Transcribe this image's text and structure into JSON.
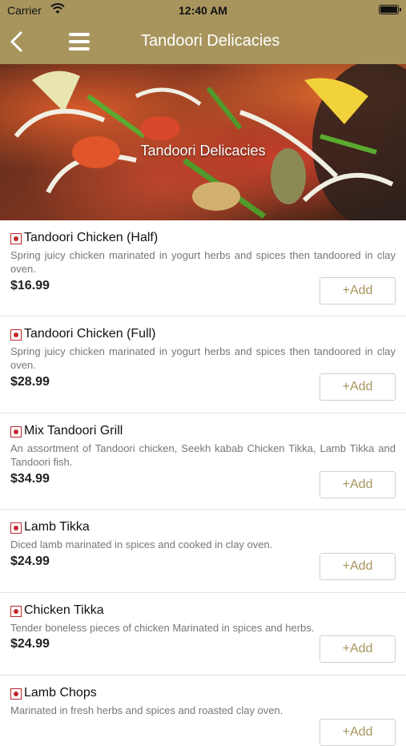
{
  "status_bar": {
    "carrier": "Carrier",
    "time": "12:40 AM"
  },
  "nav": {
    "title": "Tandoori Delicacies"
  },
  "banner": {
    "title": "Tandoori Delicacies"
  },
  "add_label": "+Add",
  "items": [
    {
      "name": "Tandoori Chicken (Half)",
      "desc": "Spring juicy chicken marinated in yogurt herbs and spices then tandoored in clay oven.",
      "price": "$16.99"
    },
    {
      "name": "Tandoori Chicken (Full)",
      "desc": "Spring juicy chicken marinated in yogurt herbs and spices then tandoored in clay oven.",
      "price": "$28.99"
    },
    {
      "name": "Mix Tandoori Grill",
      "desc": "An assortment of Tandoori chicken, Seekh kabab Chicken Tikka, Lamb Tikka and Tandoori fish.",
      "price": "$34.99"
    },
    {
      "name": "Lamb Tikka",
      "desc": "Diced lamb marinated in spices and cooked in clay oven.",
      "price": "$24.99"
    },
    {
      "name": "Chicken Tikka",
      "desc": "Tender boneless pieces of chicken Marinated in spices and herbs.",
      "price": "$24.99"
    },
    {
      "name": "Lamb Chops",
      "desc": "Marinated in fresh herbs and spices and roasted clay oven.",
      "price": ""
    }
  ],
  "colors": {
    "header": "#a8955e",
    "accent": "#a8955e",
    "veg_mark": "#c0272d"
  }
}
